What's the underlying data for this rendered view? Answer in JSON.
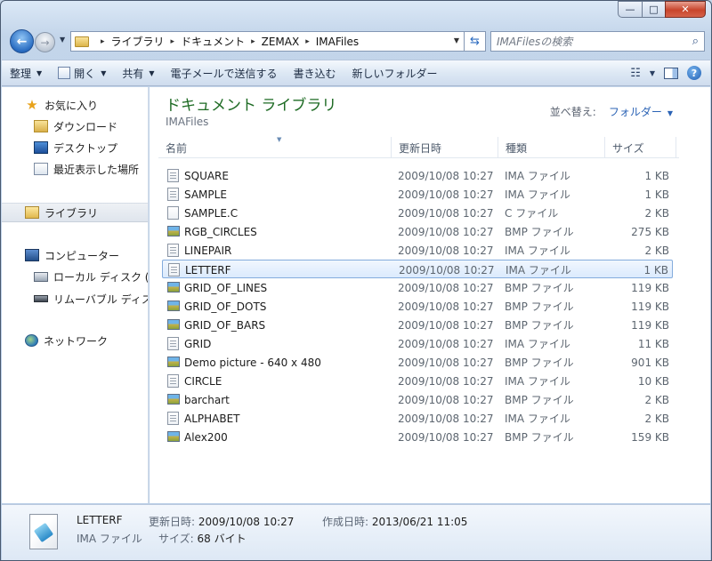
{
  "window": {
    "min_glyph": "—",
    "max_glyph": "□",
    "close_glyph": "✕"
  },
  "address": {
    "crumbs": [
      "ライブラリ",
      "ドキュメント",
      "ZEMAX",
      "IMAFiles"
    ],
    "separator": "▸",
    "dropdown": "▼"
  },
  "search": {
    "placeholder": "IMAFilesの検索"
  },
  "toolbar": {
    "organize": "整理",
    "open": "開く",
    "share": "共有",
    "email": "電子メールで送信する",
    "burn": "書き込む",
    "new_folder": "新しいフォルダー"
  },
  "nav": {
    "favorites": "お気に入り",
    "downloads": "ダウンロード",
    "desktop": "デスクトップ",
    "recent": "最近表示した場所",
    "libraries": "ライブラリ",
    "computer": "コンピューター",
    "local_disk": "ローカル ディスク (C",
    "removable": "リムーバブル ディスク",
    "network": "ネットワーク"
  },
  "library": {
    "title": "ドキュメント ライブラリ",
    "subtitle": "IMAFiles",
    "arrange_label": "並べ替え:",
    "arrange_value": "フォルダー"
  },
  "columns": {
    "name": "名前",
    "date": "更新日時",
    "type": "種類",
    "size": "サイズ"
  },
  "files": [
    {
      "name": "SQUARE",
      "date": "2009/10/08 10:27",
      "type": "IMA ファイル",
      "size": "1 KB",
      "kind": "doc"
    },
    {
      "name": "SAMPLE",
      "date": "2009/10/08 10:27",
      "type": "IMA ファイル",
      "size": "1 KB",
      "kind": "doc"
    },
    {
      "name": "SAMPLE.C",
      "date": "2009/10/08 10:27",
      "type": "C ファイル",
      "size": "2 KB",
      "kind": "blank"
    },
    {
      "name": "RGB_CIRCLES",
      "date": "2009/10/08 10:27",
      "type": "BMP ファイル",
      "size": "275 KB",
      "kind": "bmp"
    },
    {
      "name": "LINEPAIR",
      "date": "2009/10/08 10:27",
      "type": "IMA ファイル",
      "size": "2 KB",
      "kind": "doc"
    },
    {
      "name": "LETTERF",
      "date": "2009/10/08 10:27",
      "type": "IMA ファイル",
      "size": "1 KB",
      "kind": "doc",
      "selected": true
    },
    {
      "name": "GRID_OF_LINES",
      "date": "2009/10/08 10:27",
      "type": "BMP ファイル",
      "size": "119 KB",
      "kind": "bmp"
    },
    {
      "name": "GRID_OF_DOTS",
      "date": "2009/10/08 10:27",
      "type": "BMP ファイル",
      "size": "119 KB",
      "kind": "bmp"
    },
    {
      "name": "GRID_OF_BARS",
      "date": "2009/10/08 10:27",
      "type": "BMP ファイル",
      "size": "119 KB",
      "kind": "bmp"
    },
    {
      "name": "GRID",
      "date": "2009/10/08 10:27",
      "type": "IMA ファイル",
      "size": "11 KB",
      "kind": "doc"
    },
    {
      "name": "Demo picture -  640 x 480",
      "date": "2009/10/08 10:27",
      "type": "BMP ファイル",
      "size": "901 KB",
      "kind": "bmp"
    },
    {
      "name": "CIRCLE",
      "date": "2009/10/08 10:27",
      "type": "IMA ファイル",
      "size": "10 KB",
      "kind": "doc"
    },
    {
      "name": "barchart",
      "date": "2009/10/08 10:27",
      "type": "BMP ファイル",
      "size": "2 KB",
      "kind": "bmp"
    },
    {
      "name": "ALPHABET",
      "date": "2009/10/08 10:27",
      "type": "IMA ファイル",
      "size": "2 KB",
      "kind": "doc"
    },
    {
      "name": "Alex200",
      "date": "2009/10/08 10:27",
      "type": "BMP ファイル",
      "size": "159 KB",
      "kind": "bmp"
    }
  ],
  "details": {
    "name": "LETTERF",
    "type": "IMA ファイル",
    "modified_label": "更新日時:",
    "modified_value": "2009/10/08 10:27",
    "created_label": "作成日時:",
    "created_value": "2013/06/21 11:05",
    "size_label": "サイズ:",
    "size_value": "68 バイト"
  }
}
